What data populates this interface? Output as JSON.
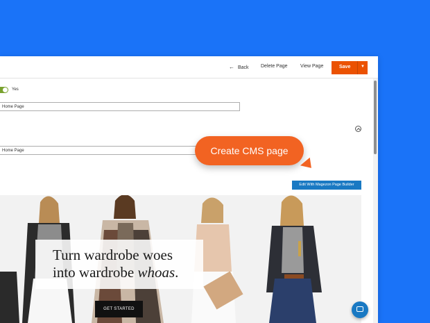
{
  "toolbar": {
    "back_label": "Back",
    "delete_label": "Delete Page",
    "view_label": "View Page",
    "save_label": "Save"
  },
  "form": {
    "enable_toggle_label": "Yes",
    "enable_toggle_on": true,
    "title_value": "Home Page",
    "meta_title_value": "Home Page"
  },
  "callout": {
    "text": "Create CMS page"
  },
  "builder_button": {
    "label": "Edit With Magezon Page Builder"
  },
  "banner": {
    "headline_line1": "Turn wardrobe woes",
    "headline_line2_prefix": "into wardrobe ",
    "headline_line2_emphasis": "whoas",
    "headline_line2_suffix": ".",
    "cta_label": "GET STARTED"
  },
  "colors": {
    "background": "#1a73f8",
    "save_orange": "#eb5202",
    "callout_orange": "#f26322",
    "builder_blue": "#1979c3",
    "toggle_green": "#79a22e"
  },
  "icons": {
    "back": "arrow-left-icon",
    "save_menu": "caret-down-icon",
    "collapse": "chevron-up-circle-icon",
    "chat": "chat-icon"
  }
}
